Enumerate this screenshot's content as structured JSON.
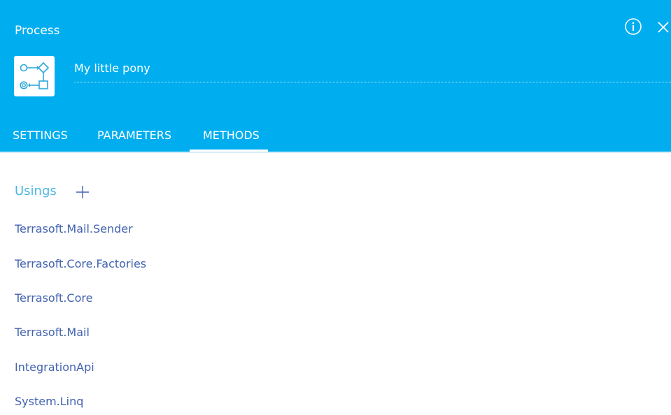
{
  "window": {
    "title": "Process",
    "info_icon": "info-icon",
    "close_icon": "close-icon"
  },
  "process": {
    "icon": "process-diagram-icon",
    "name": "My little pony"
  },
  "tabs": [
    {
      "label": "SETTINGS",
      "active": false
    },
    {
      "label": "PARAMETERS",
      "active": false
    },
    {
      "label": "METHODS",
      "active": true
    }
  ],
  "usings": {
    "title": "Usings",
    "add_icon": "plus-icon",
    "items": [
      "Terrasoft.Mail.Sender",
      "Terrasoft.Core.Factories",
      "Terrasoft.Core",
      "Terrasoft.Mail",
      "IntegrationApi",
      "System.Linq"
    ]
  },
  "colors": {
    "header": "#00aeef",
    "section_title": "#4fb6e2",
    "link": "#4262b0",
    "text_on_header": "#ffffff"
  }
}
